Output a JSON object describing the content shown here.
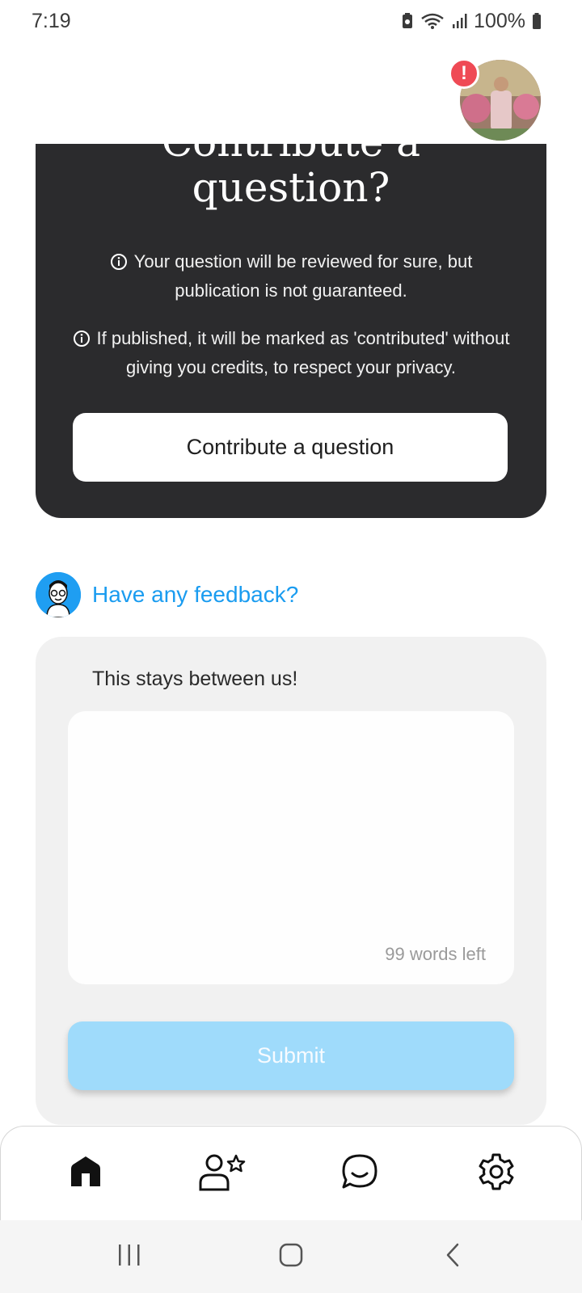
{
  "status_bar": {
    "time": "7:19",
    "battery": "100%"
  },
  "contribute": {
    "title_line1": "Contribute a",
    "title_line2": "question?",
    "notice_1": "Your question will be reviewed for sure, but publication is not guaranteed.",
    "notice_2": "If published, it will be marked as 'contributed' without giving you credits, to respect your privacy.",
    "button_label": "Contribute a question"
  },
  "profile": {
    "alert_badge": "!"
  },
  "feedback": {
    "title": "Have any feedback?",
    "subtitle": "This stays between us!",
    "words_left": "99 words left",
    "submit_label": "Submit"
  },
  "colors": {
    "accent": "#1a9cf0",
    "card_dark": "#2b2b2d",
    "submit_disabled": "#9fdbfb",
    "alert": "#ef4a55"
  },
  "icons": {
    "nav": [
      "home-icon",
      "profile-star-icon",
      "chat-icon",
      "settings-gear-icon"
    ],
    "system": [
      "recents-icon",
      "home-circle-icon",
      "back-icon"
    ]
  }
}
